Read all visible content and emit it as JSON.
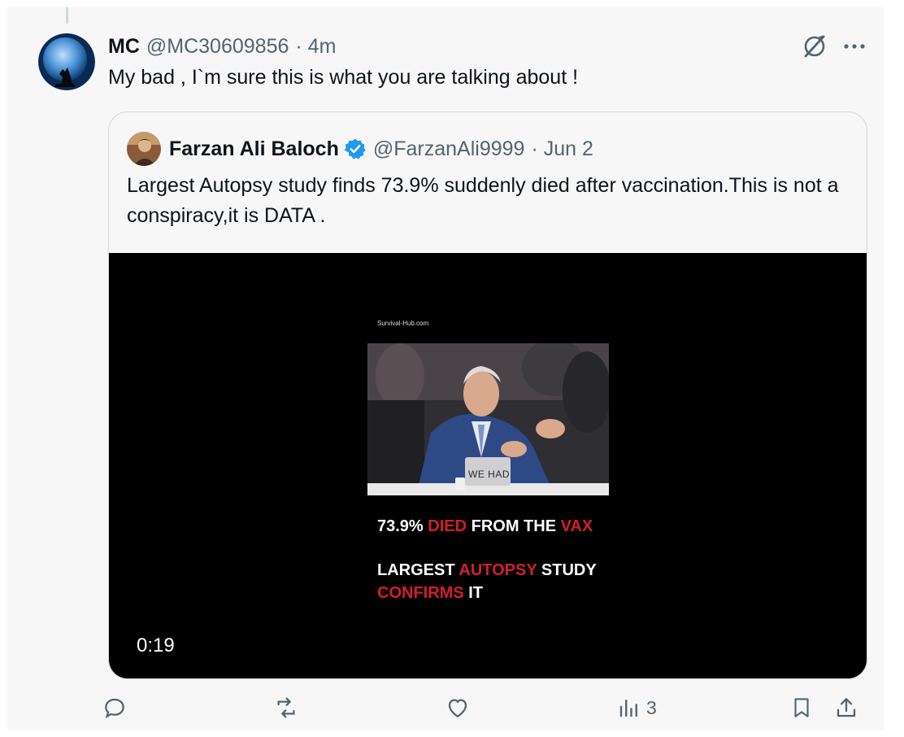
{
  "reply": {
    "display_name": "MC",
    "handle": "@MC30609856",
    "time": "· 4m",
    "text": "My bad , I`m sure this is what you are talking about !"
  },
  "quoted": {
    "display_name": "Farzan Ali Baloch",
    "handle": "@FarzanAli9999",
    "date": "· Jun 2",
    "text": "Largest Autopsy study finds 73.9% suddenly died after vaccination.This is not a conspiracy,it is DATA .",
    "media": {
      "site_watermark": "Survival-Hub.com",
      "frame_caption": "WE HAD",
      "line1": [
        "73.9% ",
        "DIED",
        " FROM THE ",
        "VAX"
      ],
      "line2": [
        "LARGEST ",
        "AUTOPSY",
        " STUDY"
      ],
      "line3": [
        "CONFIRMS",
        " IT"
      ],
      "duration": "0:19"
    }
  },
  "actions": {
    "views": "3"
  },
  "colors": {
    "background": "#f7f7f7",
    "accent_red": "#d0202a",
    "verified_blue": "#1d9bf0",
    "muted_text": "#536471"
  },
  "icons": [
    "grok-icon",
    "more-icon",
    "verified-icon",
    "reply-icon",
    "repost-icon",
    "like-icon",
    "views-icon",
    "bookmark-icon",
    "share-icon"
  ]
}
